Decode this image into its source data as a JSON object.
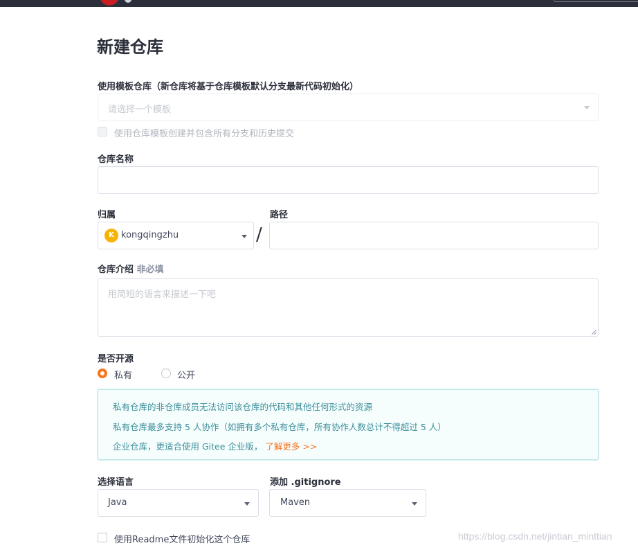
{
  "page_title": "新建仓库",
  "template": {
    "label": "使用模板仓库（新仓库将基于仓库模板默认分支最新代码初始化）",
    "placeholder": "请选择一个模板",
    "include_all_label": "使用仓库模板创建并包含所有分支和历史提交"
  },
  "repo_name": {
    "label": "仓库名称",
    "value": ""
  },
  "owner": {
    "label": "归属",
    "avatar_letter": "K",
    "value": "kongqingzhu"
  },
  "path": {
    "label": "路径",
    "separator": "/",
    "value": ""
  },
  "description": {
    "label": "仓库介绍",
    "optional_tag": "非必填",
    "placeholder": "用简短的语言来描述一下吧"
  },
  "visibility": {
    "label": "是否开源",
    "options": [
      {
        "label": "私有",
        "selected": true
      },
      {
        "label": "公开",
        "selected": false
      }
    ]
  },
  "info_box": {
    "line1": "私有仓库的非仓库成员无法访问该仓库的代码和其他任何形式的资源",
    "line2": "私有仓库最多支持 5 人协作（如拥有多个私有仓库，所有协作人数总计不得超过 5 人）",
    "line3": "企业仓库，更适合使用 Gitee 企业版，",
    "link": "了解更多 >>"
  },
  "language": {
    "label": "选择语言",
    "value": "Java"
  },
  "gitignore": {
    "label": "添加 .gitignore",
    "value": "Maven"
  },
  "readme": {
    "label": "使用Readme文件初始化这个仓库",
    "checked": false
  },
  "watermark": "https://blog.csdn.net/jintian_minttian",
  "colors": {
    "accent": "#f5761f",
    "info_text": "#3b8f9a",
    "info_bg": "#f6fdfd",
    "topbar": "#2b2f3a"
  }
}
